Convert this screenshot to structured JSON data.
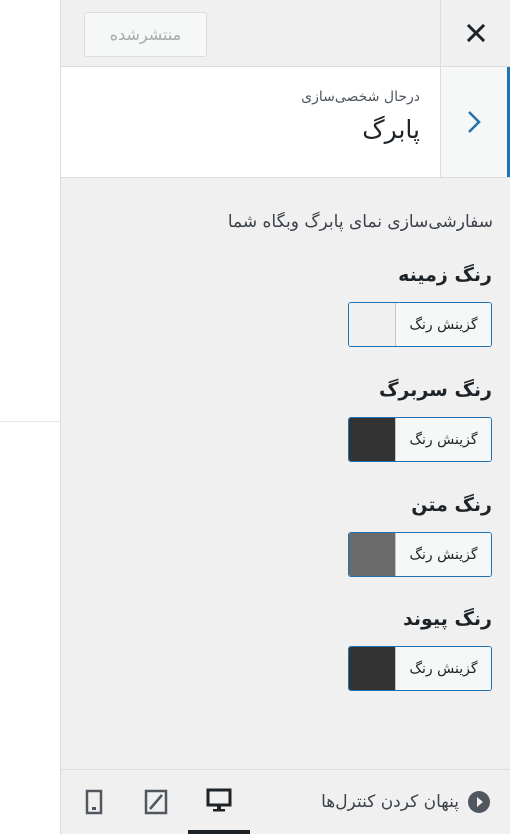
{
  "topbar": {
    "publish_label": "منتشرشده"
  },
  "section": {
    "subtitle": "درحال شخصی‌سازی",
    "title": "پابرگ"
  },
  "description": "سفارشی‌سازی نمای پابرگ وبگاه شما",
  "controls": [
    {
      "label": "رنگ زمینه",
      "button_label": "گزینش رنگ",
      "color": "#f0f0f1"
    },
    {
      "label": "رنگ سربرگ",
      "button_label": "گزینش رنگ",
      "color": "#333333"
    },
    {
      "label": "رنگ متن",
      "button_label": "گزینش رنگ",
      "color": "#6b6b6b"
    },
    {
      "label": "رنگ پیوند",
      "button_label": "گزینش رنگ",
      "color": "#333333"
    }
  ],
  "footer": {
    "hide_label": "پنهان کردن کنترل‌ها",
    "active_device": "desktop"
  },
  "accent_color": "#2271b1"
}
